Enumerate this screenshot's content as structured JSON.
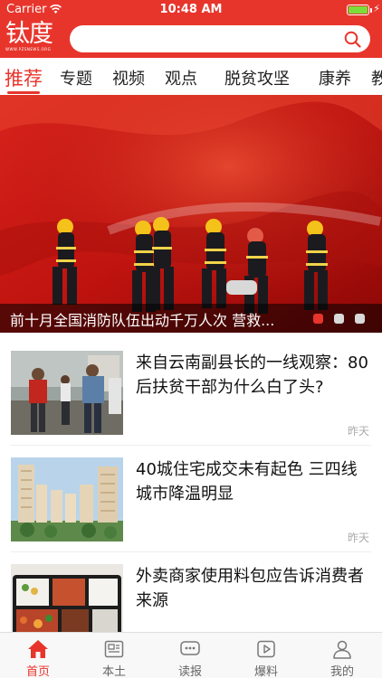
{
  "status_bar": {
    "carrier": "Carrier",
    "time": "10:48 AM",
    "battery_level": 1.0
  },
  "header": {
    "logo_text": "钛度",
    "logo_sub": "WWW.PZSNEWS.ORG",
    "search_placeholder": ""
  },
  "tabs": [
    {
      "label": "推荐",
      "active": true
    },
    {
      "label": "专题"
    },
    {
      "label": "视频"
    },
    {
      "label": "观点"
    },
    {
      "label": "脱贫攻坚"
    },
    {
      "label": "康养"
    },
    {
      "label": "教"
    }
  ],
  "banner": {
    "caption": "前十月全国消防队伍出动千万人次 营救...",
    "slide_count": 3,
    "active_index": 0
  },
  "news": [
    {
      "title": "来自云南副县长的一线观察：80后扶贫干部为什么白了头?",
      "time": "昨天",
      "thumb": "officials-photo"
    },
    {
      "title": "40城住宅成交未有起色 三四线城市降温明显",
      "time": "昨天",
      "thumb": "residential-buildings-photo"
    },
    {
      "title": "外卖商家使用料包应告诉消费者来源",
      "time": "",
      "thumb": "takeout-food-photo"
    }
  ],
  "tabbar": [
    {
      "label": "首页",
      "icon": "home-icon",
      "active": true
    },
    {
      "label": "本土",
      "icon": "newspaper-icon"
    },
    {
      "label": "读报",
      "icon": "chat-icon"
    },
    {
      "label": "爆料",
      "icon": "video-icon"
    },
    {
      "label": "我的",
      "icon": "user-icon"
    }
  ],
  "colors": {
    "brand": "#e8352c",
    "battery": "#7bdc3a"
  }
}
